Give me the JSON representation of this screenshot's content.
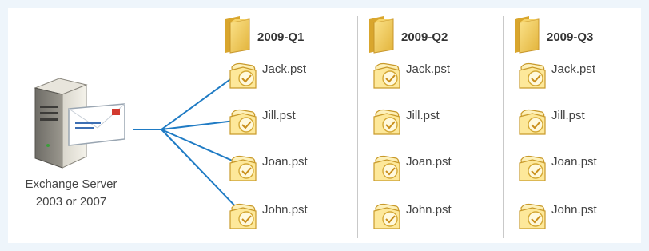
{
  "server": {
    "icon": "exchange-server-icon",
    "label_line1": "Exchange Server",
    "label_line2": "2003 or 2007"
  },
  "colors": {
    "arrow": "#1f7bc4",
    "folder": "#f2c94c",
    "divider": "#c9c9c9"
  },
  "columns": [
    {
      "title": "2009-Q1",
      "files": [
        "Jack.pst",
        "Jill.pst",
        "Joan.pst",
        "John.pst"
      ]
    },
    {
      "title": "2009-Q2",
      "files": [
        "Jack.pst",
        "Jill.pst",
        "Joan.pst",
        "John.pst"
      ]
    },
    {
      "title": "2009-Q3",
      "files": [
        "Jack.pst",
        "Jill.pst",
        "Joan.pst",
        "John.pst"
      ]
    }
  ]
}
